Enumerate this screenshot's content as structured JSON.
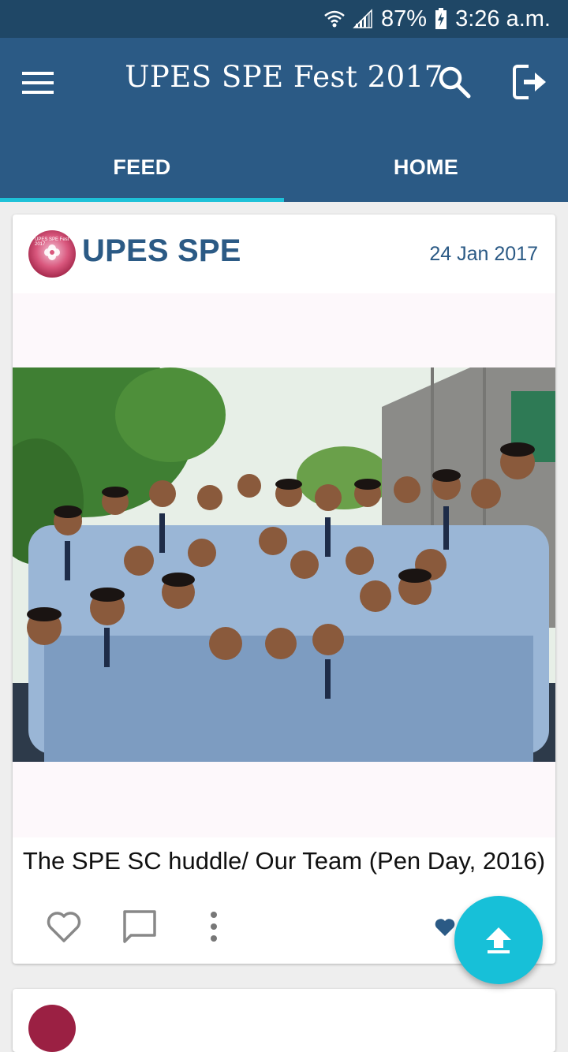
{
  "status_bar": {
    "battery": "87%",
    "time": "3:26 a.m.",
    "icons": [
      "wifi-icon",
      "signal-icon",
      "battery-charging-icon"
    ]
  },
  "app_bar": {
    "title": "UPES SPE Fest 2017",
    "menu_icon": "hamburger-menu-icon",
    "search_icon": "search-icon",
    "logout_icon": "logout-icon",
    "color": "#2b5a85"
  },
  "tabs": [
    {
      "label": "FEED",
      "active": true
    },
    {
      "label": "HOME",
      "active": false
    }
  ],
  "accent_color": "#1ec1d8",
  "post": {
    "avatar_text_top": "UPES SPE Fest 2017",
    "author": "UPES SPE",
    "date": "24 Jan 2017",
    "caption": "The SPE SC huddle/ Our Team (Pen Day, 2016)",
    "actions": [
      "heart-outline-icon",
      "comment-icon",
      "more-vertical-icon"
    ],
    "liked_icon": "heart-filled-icon"
  },
  "fab": {
    "icon": "upload-icon",
    "color": "#17c0d8"
  }
}
